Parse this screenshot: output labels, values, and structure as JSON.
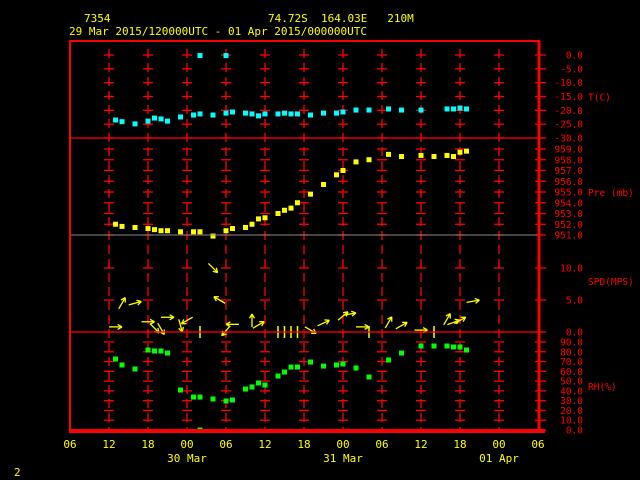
{
  "header": {
    "station_id": "7354",
    "location": "74.72S  164.03E   210M",
    "period": "29 Mar 2015/120000UTC - 01 Apr 2015/000000UTC",
    "page_number": "2"
  },
  "colors": {
    "frame": "#ff0000",
    "axis_text": "#ff0000",
    "header_text": "#ffff00",
    "temperature": "#00ffff",
    "pressure": "#ffff00",
    "wind": "#ffff00",
    "rh": "#00ff00"
  },
  "chart_data": {
    "type": "scatter",
    "x_units": "hours since 29 Mar 2015 06UTC",
    "xlim": [
      0,
      72
    ],
    "x_ticks": [
      0,
      6,
      12,
      18,
      24,
      30,
      36,
      42,
      48,
      54,
      60,
      66,
      72
    ],
    "x_tick_labels": [
      "06",
      "12",
      "18",
      "00",
      "06",
      "12",
      "18",
      "00",
      "06",
      "12",
      "18",
      "00",
      "06"
    ],
    "date_labels": [
      {
        "hour": 18,
        "text": "30 Mar"
      },
      {
        "hour": 42,
        "text": "31 Mar"
      },
      {
        "hour": 66,
        "text": "01 Apr"
      }
    ],
    "panels": [
      {
        "name": "temperature",
        "label": "T(C)",
        "ylim": [
          -30,
          0
        ],
        "ticks": [
          "0.0",
          "-5.0",
          "-10.0",
          "-15.0",
          "-20.0",
          "-25.0",
          "-30.0"
        ],
        "points": [
          [
            7,
            -23.5
          ],
          [
            8,
            -24.1
          ],
          [
            10,
            -24.9
          ],
          [
            12,
            -23.9
          ],
          [
            13,
            -22.8
          ],
          [
            14,
            -23.1
          ],
          [
            15,
            -23.9
          ],
          [
            17,
            -22.4
          ],
          [
            19,
            -21.7
          ],
          [
            20,
            -21.3
          ],
          [
            20,
            -0.2
          ],
          [
            22,
            -21.7
          ],
          [
            24,
            -21.0
          ],
          [
            24,
            -0.2
          ],
          [
            25,
            -20.6
          ],
          [
            27,
            -21.0
          ],
          [
            28,
            -21.3
          ],
          [
            29,
            -22.0
          ],
          [
            30,
            -21.3
          ],
          [
            32,
            -21.3
          ],
          [
            33,
            -21.0
          ],
          [
            34,
            -21.3
          ],
          [
            35,
            -21.3
          ],
          [
            37,
            -21.7
          ],
          [
            39,
            -21.0
          ],
          [
            41,
            -21.0
          ],
          [
            42,
            -20.6
          ],
          [
            44,
            -19.9
          ],
          [
            46,
            -19.9
          ],
          [
            49,
            -19.5
          ],
          [
            51,
            -19.9
          ],
          [
            54,
            -19.9
          ],
          [
            58,
            -19.5
          ],
          [
            59,
            -19.5
          ],
          [
            60,
            -19.2
          ],
          [
            61,
            -19.5
          ]
        ]
      },
      {
        "name": "pressure",
        "label": "Pre (mb)",
        "ylim": [
          951,
          959
        ],
        "ticks": [
          "959.0",
          "958.0",
          "957.0",
          "956.0",
          "955.0",
          "954.0",
          "953.0",
          "952.0",
          "951.0"
        ],
        "points": [
          [
            7,
            952.0
          ],
          [
            8,
            951.8
          ],
          [
            10,
            951.7
          ],
          [
            12,
            951.6
          ],
          [
            13,
            951.5
          ],
          [
            14,
            951.4
          ],
          [
            15,
            951.4
          ],
          [
            17,
            951.3
          ],
          [
            19,
            951.3
          ],
          [
            20,
            951.3
          ],
          [
            22,
            950.9
          ],
          [
            24,
            951.4
          ],
          [
            25,
            951.6
          ],
          [
            27,
            951.7
          ],
          [
            28,
            952.0
          ],
          [
            29,
            952.5
          ],
          [
            30,
            952.6
          ],
          [
            32,
            953.0
          ],
          [
            33,
            953.3
          ],
          [
            34,
            953.5
          ],
          [
            35,
            954.0
          ],
          [
            37,
            954.8
          ],
          [
            39,
            955.7
          ],
          [
            41,
            956.6
          ],
          [
            42,
            957.0
          ],
          [
            44,
            957.8
          ],
          [
            46,
            958.0
          ],
          [
            49,
            958.5
          ],
          [
            51,
            958.3
          ],
          [
            54,
            958.4
          ],
          [
            56,
            958.3
          ],
          [
            58,
            958.4
          ],
          [
            59,
            958.3
          ],
          [
            60,
            958.7
          ],
          [
            61,
            958.8
          ]
        ]
      },
      {
        "name": "wind",
        "label": "SPD(MPS)",
        "ylim": [
          0,
          10
        ],
        "ticks": [
          "10.0",
          "5.0",
          "0.0"
        ],
        "points_note": "[hour, speed, arrow_direction_deg_clockwise_from_up or null for calm]",
        "points": [
          [
            7,
            0.8,
            90
          ],
          [
            8,
            4.5,
            30
          ],
          [
            10,
            4.5,
            75
          ],
          [
            12,
            1.6,
            90
          ],
          [
            13,
            0.6,
            135
          ],
          [
            14,
            0.5,
            150
          ],
          [
            15,
            2.3,
            90
          ],
          [
            17,
            1.0,
            165
          ],
          [
            18,
            1.8,
            240
          ],
          [
            20,
            0,
            null
          ],
          [
            22,
            10,
            135
          ],
          [
            23,
            5,
            300
          ],
          [
            24,
            0.2,
            220
          ],
          [
            25,
            1.2,
            270
          ],
          [
            28,
            1.8,
            0
          ],
          [
            29,
            1.1,
            60
          ],
          [
            32,
            0,
            null
          ],
          [
            33,
            0,
            null
          ],
          [
            34,
            0,
            null
          ],
          [
            35,
            0,
            null
          ],
          [
            37,
            0.3,
            120
          ],
          [
            39,
            1.4,
            65
          ],
          [
            42,
            2.5,
            50
          ],
          [
            43,
            2.8,
            80
          ],
          [
            45,
            0.8,
            90
          ],
          [
            46,
            0,
            null
          ],
          [
            49,
            1.5,
            30
          ],
          [
            51,
            1.0,
            60
          ],
          [
            54,
            0.3,
            90
          ],
          [
            56,
            0,
            null
          ],
          [
            58,
            2.0,
            30
          ],
          [
            59,
            1.5,
            70
          ],
          [
            60,
            1.8,
            60
          ],
          [
            62,
            4.8,
            80
          ]
        ]
      },
      {
        "name": "rh",
        "label": "RH(%)",
        "ylim": [
          0,
          90
        ],
        "ticks": [
          "90.0",
          "80.0",
          "70.0",
          "60.0",
          "50.0",
          "40.0",
          "30.0",
          "20.0",
          "10.0",
          "0.0"
        ],
        "points": [
          [
            7,
            72.6
          ],
          [
            8,
            66.5
          ],
          [
            10,
            62.4
          ],
          [
            12,
            81.8
          ],
          [
            13,
            80.8
          ],
          [
            14,
            80.8
          ],
          [
            15,
            78.7
          ],
          [
            17,
            40.9
          ],
          [
            19,
            33.7
          ],
          [
            20,
            33.7
          ],
          [
            20,
            0
          ],
          [
            22,
            31.7
          ],
          [
            24,
            29.7
          ],
          [
            25,
            30.7
          ],
          [
            27,
            41.9
          ],
          [
            28,
            44.0
          ],
          [
            29,
            48.1
          ],
          [
            30,
            46.0
          ],
          [
            32,
            55.2
          ],
          [
            33,
            59.3
          ],
          [
            34,
            64.4
          ],
          [
            35,
            64.4
          ],
          [
            37,
            69.5
          ],
          [
            39,
            65.4
          ],
          [
            41,
            66.5
          ],
          [
            42,
            67.5
          ],
          [
            44,
            63.4
          ],
          [
            46,
            54.2
          ],
          [
            49,
            71.6
          ],
          [
            51,
            78.7
          ],
          [
            54,
            85.9
          ],
          [
            56,
            85.9
          ],
          [
            58,
            85.9
          ],
          [
            59,
            84.9
          ],
          [
            60,
            84.9
          ],
          [
            61,
            81.8
          ]
        ]
      }
    ]
  }
}
